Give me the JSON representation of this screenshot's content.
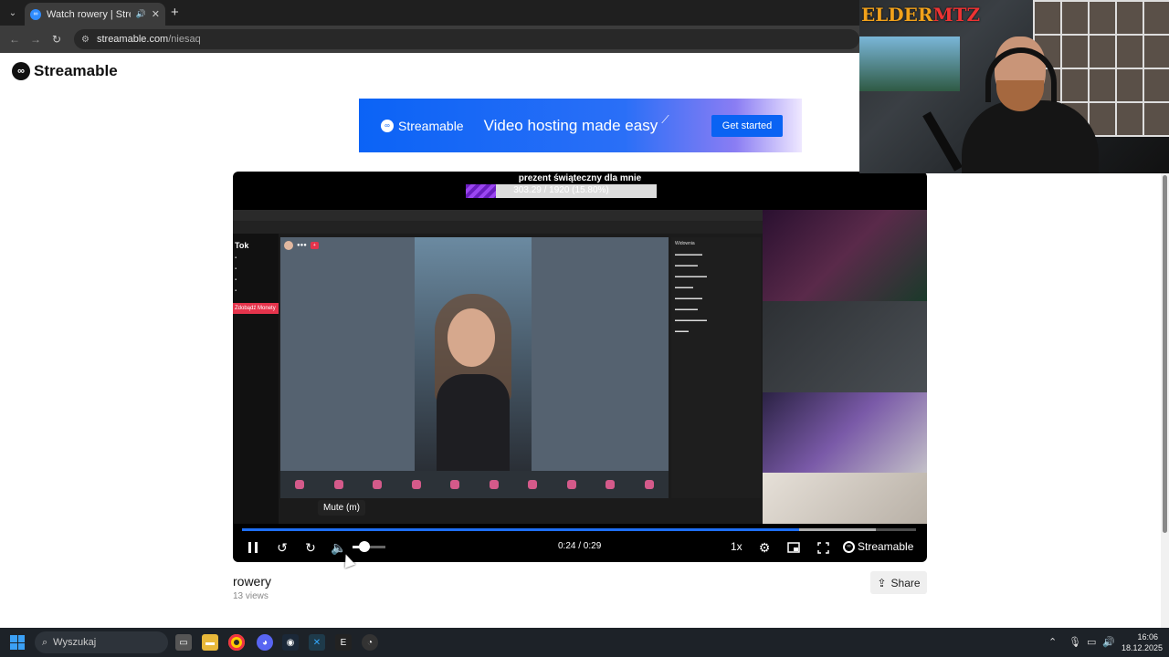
{
  "browser": {
    "tab_title": "Watch rowery | Streamable",
    "new_tab": "+",
    "url_host": "streamable.com",
    "url_path": "/niesaq"
  },
  "site": {
    "logo_text": "Streamable"
  },
  "banner": {
    "logo_text": "Streamable",
    "tagline": "Video hosting made easy",
    "cta": "Get started"
  },
  "player": {
    "goal_title": "prezent świąteczny dla mnie",
    "goal_text": "303.29 / 1920 (15.80%)",
    "goal_fraction": 0.158,
    "tooltip": "Mute (m)",
    "time": "0:24 / 0:29",
    "played_fraction": 0.827,
    "buffered_fraction": 0.94,
    "volume_fraction": 0.35,
    "rate": "1x",
    "brand": "Streamable",
    "tiktok_brand": "Tok",
    "tiktok_moneys": "Zdobądź Monety",
    "chat_header": "Widownia"
  },
  "video": {
    "title": "rowery",
    "views": "13 views",
    "share": "Share"
  },
  "webcam": {
    "overlay_text": "ELDERMTZ"
  },
  "taskbar": {
    "search_placeholder": "Wyszukaj",
    "time": "16:06",
    "date": "18.12.2025"
  },
  "colors": {
    "accent": "#1e6ff5",
    "banner_cta": "#0a63f3",
    "tiktok_red": "#e5344c",
    "goal_purple": "#6a1fbf"
  }
}
